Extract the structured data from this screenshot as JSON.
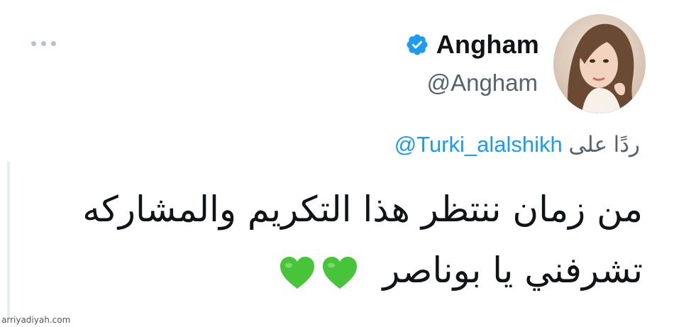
{
  "tweet": {
    "author": {
      "display_name": "Angham",
      "handle": "@Angham",
      "verified": true,
      "avatar_icon": "profile-photo"
    },
    "more_icon": "more-dots-icon",
    "reply": {
      "prefix": "ردًا على",
      "mention": "@Turki_alalshikh"
    },
    "text": {
      "line1": "من زمان ننتظر هذا التكريم والمشاركه",
      "line2": "تشرفني  يا بوناصر"
    },
    "emojis": [
      "green-heart",
      "green-heart"
    ]
  },
  "watermark": "arriyadiyah.com",
  "colors": {
    "accent": "#1d9bf0",
    "text": "#0f1419",
    "muted": "#536471",
    "heart": "#47c43a"
  }
}
